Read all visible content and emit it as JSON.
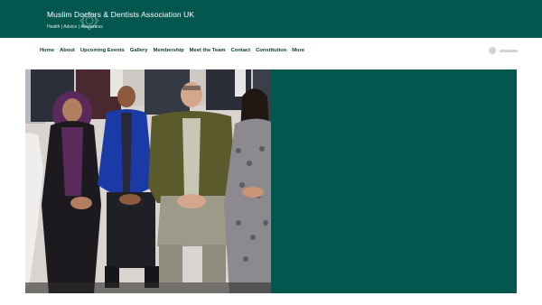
{
  "header": {
    "title": "Muslim Doctors & Dentists Association UK",
    "tagline": "Health |  Advice | Awareness"
  },
  "nav": {
    "items": [
      "Home",
      "About",
      "Upcoming Events",
      "Gallery",
      "Membership",
      "Meet the Team",
      "Contact",
      "Constitution",
      "More"
    ]
  },
  "colors": {
    "brand": "#04574f",
    "nav_text": "#0d3b37"
  },
  "icons": {
    "logo": "geometric-star-logo-icon"
  }
}
